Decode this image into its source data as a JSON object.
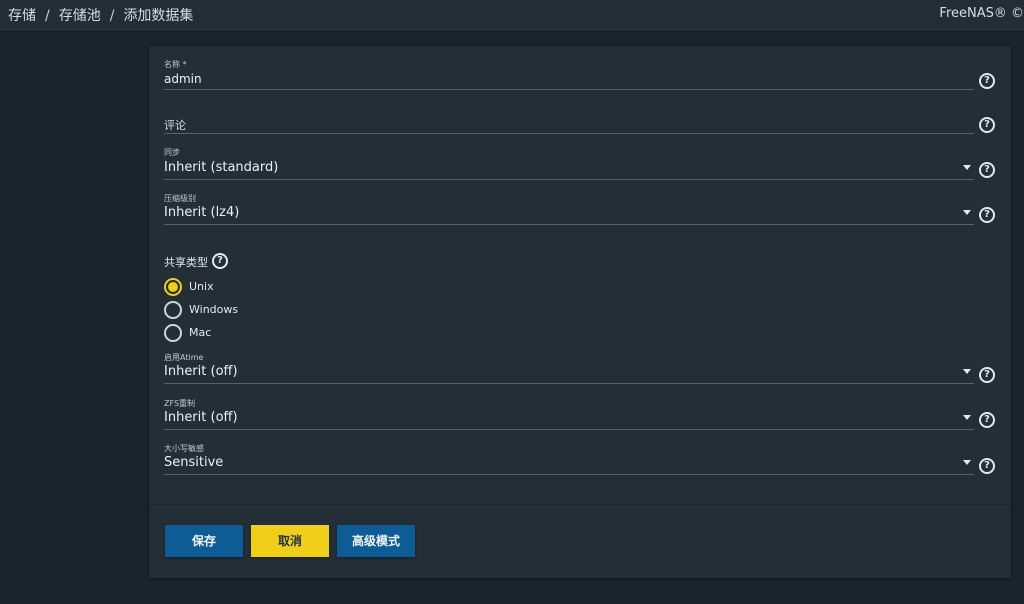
{
  "breadcrumb": {
    "items": [
      "存储",
      "存储池",
      "添加数据集"
    ],
    "separator": "/"
  },
  "brand": "FreeNAS® ©",
  "form": {
    "name": {
      "label": "名称 *",
      "value": "admin"
    },
    "comment": {
      "placeholder": "评论"
    },
    "sync": {
      "label": "同步",
      "value": "Inherit (standard)"
    },
    "compression": {
      "label": "压缩级别",
      "value": "Inherit (lz4)"
    },
    "share_type": {
      "label": "共享类型",
      "options": [
        "Unix",
        "Windows",
        "Mac"
      ],
      "selected": "Unix"
    },
    "atime": {
      "label": "启用Atime",
      "value": "Inherit (off)"
    },
    "zfs_dedup": {
      "label": "ZFS重制",
      "value": "Inherit (off)"
    },
    "case_sensitivity": {
      "label": "大小写敏感",
      "value": "Sensitive"
    }
  },
  "buttons": {
    "save": "保存",
    "cancel": "取消",
    "advanced": "高级模式"
  },
  "colors": {
    "primary": "#0d5c95",
    "accent": "#f0cf1b",
    "background": "#1b232b",
    "card": "#232e37"
  },
  "icons": {
    "help": "help-circle-icon",
    "dropdown": "caret-down-icon"
  }
}
